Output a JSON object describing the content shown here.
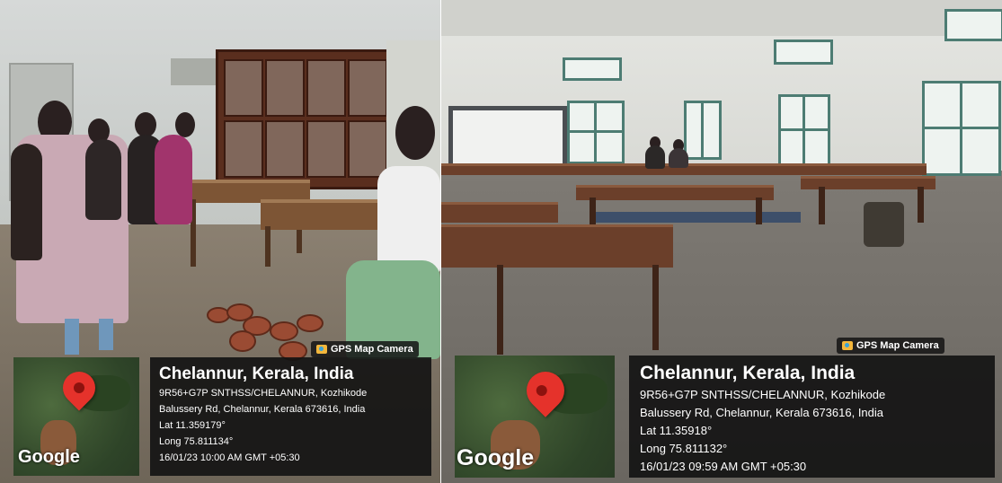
{
  "panels": [
    {
      "gps_tag": "GPS Map Camera",
      "map_logo": "Google",
      "title": "Chelannur, Kerala, India",
      "lines": [
        "9R56+G7P SNTHSS/CHELANNUR, Kozhikode",
        "Balussery Rd, Chelannur, Kerala 673616, India",
        "Lat 11.359179°",
        "Long 75.811134°",
        "16/01/23 10:00 AM GMT +05:30"
      ]
    },
    {
      "gps_tag": "GPS Map Camera",
      "map_logo": "Google",
      "title": "Chelannur, Kerala, India",
      "lines": [
        "9R56+G7P SNTHSS/CHELANNUR, Kozhikode",
        "Balussery Rd, Chelannur, Kerala 673616, India",
        "Lat 11.35918°",
        "Long 75.811132°",
        "16/01/23 09:59 AM GMT +05:30"
      ]
    }
  ],
  "icons": {
    "gps_camera": "camera-icon",
    "map_pin": "map-pin-icon"
  },
  "colors": {
    "pin": "#e5322b",
    "overlay": "#121212"
  }
}
